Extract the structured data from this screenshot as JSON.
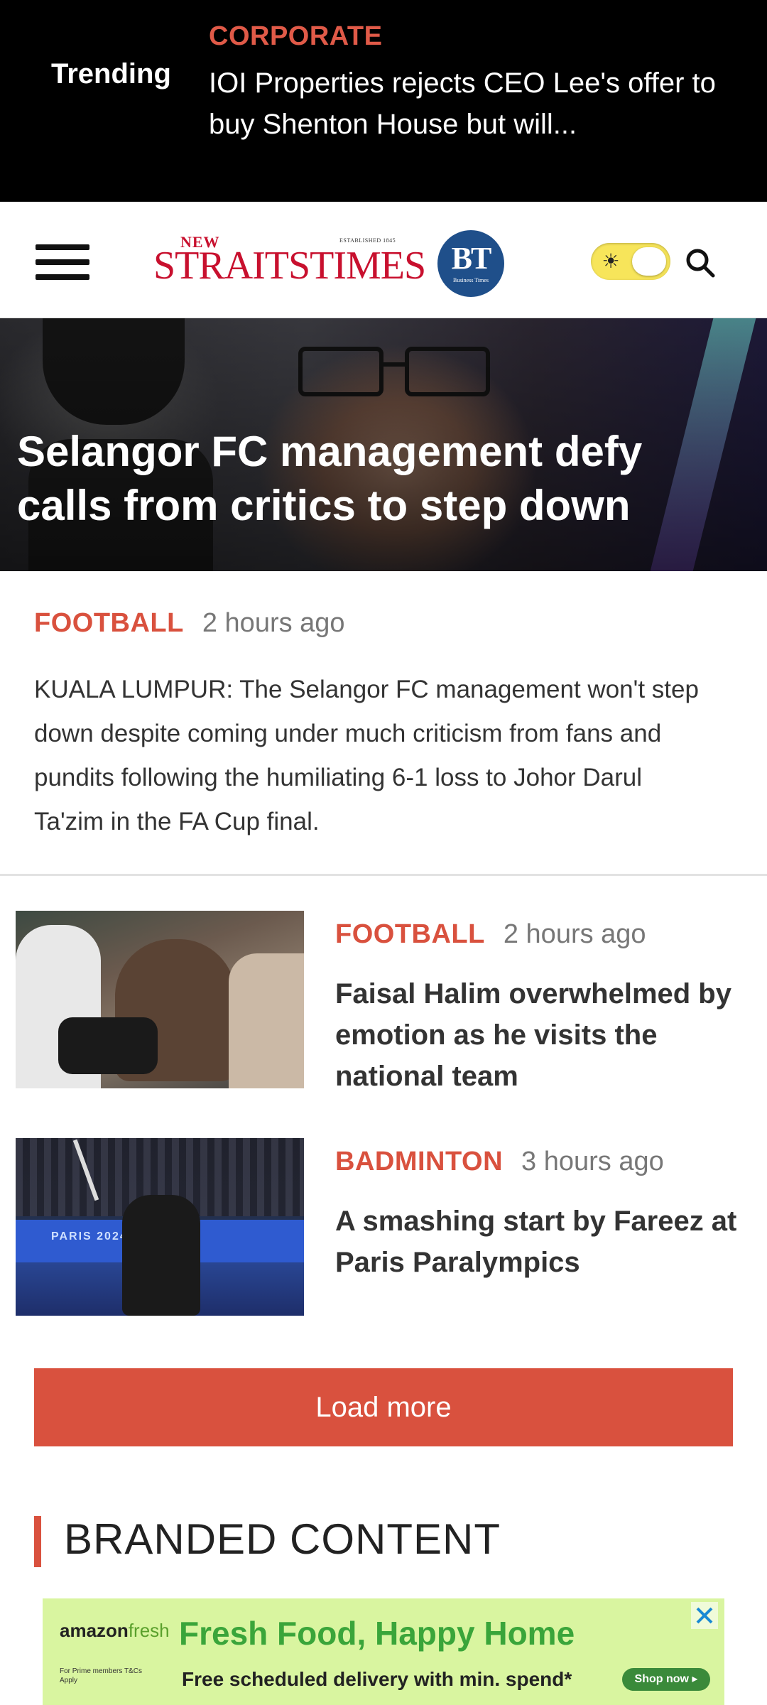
{
  "trending": {
    "label": "Trending",
    "category": "CORPORATE",
    "headline": "IOI Properties rejects CEO Lee's offer to buy Shenton House but will..."
  },
  "header": {
    "logo_nst_new": "NEW",
    "logo_nst_established": "ESTABLISHED 1845",
    "logo_nst_main": "STRAITSTIMES",
    "logo_bt_main": "BT",
    "logo_bt_sub": "Business Times"
  },
  "hero": {
    "title": "Selangor FC management defy calls from critics to step down",
    "category": "FOOTBALL",
    "time": "2 hours ago",
    "excerpt": "KUALA LUMPUR: The Selangor FC management won't step down despite coming under much criticism from fans and pundits following the humiliating 6-1 loss to Johor Darul Ta'zim in the FA Cup final."
  },
  "articles": [
    {
      "category": "FOOTBALL",
      "time": "2 hours ago",
      "title": "Faisal Halim overwhelmed by emotion as he visits the national team"
    },
    {
      "category": "BADMINTON",
      "time": "3 hours ago",
      "title": "A smashing start by Fareez at Paris Paralympics",
      "thumb_text": "PARIS 2024"
    }
  ],
  "load_more_label": "Load more",
  "branded_content_title": "BRANDED CONTENT",
  "ad": {
    "brand_prefix": "amazon",
    "brand_suffix": "fresh",
    "headline": "Fresh Food, Happy Home",
    "terms": "For Prime members T&Cs Apply",
    "subline": "Free scheduled delivery with min. spend*",
    "cta": "Shop now ▸"
  },
  "colors": {
    "accent": "#d9513e",
    "trending_bg": "#000000",
    "toggle": "#f7e55a",
    "ad_bg": "#d9f5a0"
  },
  "icons": [
    "menu-icon",
    "sun-icon",
    "search-icon",
    "close-icon"
  ]
}
